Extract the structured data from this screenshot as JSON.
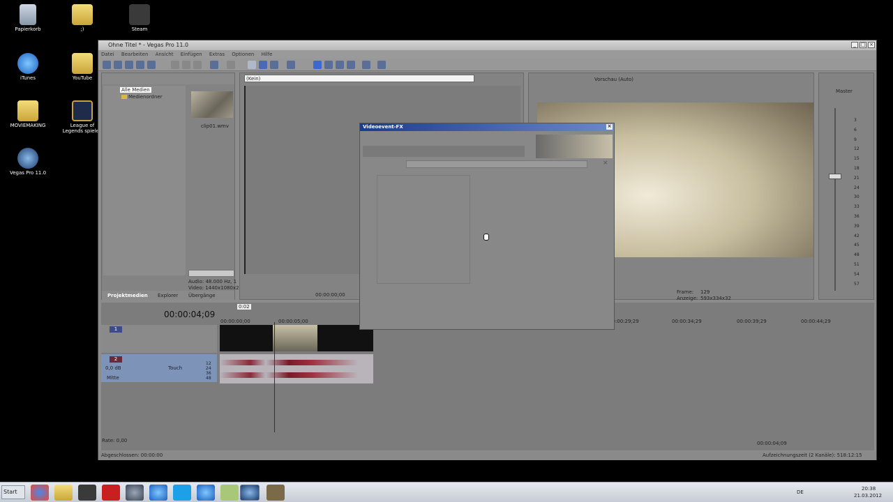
{
  "desktop": {
    "icons": [
      {
        "label": "Papierkorb"
      },
      {
        "label": ";)"
      },
      {
        "label": "Steam"
      },
      {
        "label": "iTunes"
      },
      {
        "label": "YouTube"
      },
      {
        "label": "MOVIEMAKING"
      },
      {
        "label": "League of Legends spielen"
      },
      {
        "label": "Vegas Pro 11.0"
      }
    ]
  },
  "window": {
    "title": "Ohne Titel * - Vegas Pro 11.0",
    "menu": [
      "Datei",
      "Bearbeiten",
      "Ansicht",
      "Einfügen",
      "Extras",
      "Optionen",
      "Hilfe"
    ]
  },
  "media": {
    "tree": [
      "Alle Medien",
      "Medienordner"
    ],
    "file_name": "clip01.wmv",
    "info_lines": [
      "Audio: 48.000 Hz, 1",
      "Video: 1440x1080x2"
    ],
    "tabs": [
      "Projektmedien",
      "Explorer",
      "Übergänge"
    ]
  },
  "trimmer": {
    "selector_value": "(Kein)",
    "timecode": "00:00:00;00"
  },
  "preview": {
    "mode": "Vorschau (Auto)",
    "frame_label": "Frame:",
    "frame_value": "129",
    "display_label": "Anzeige:",
    "display_value": "593x334x32"
  },
  "mixer": {
    "master_label": "Master",
    "scale": [
      "3",
      "6",
      "9",
      "12",
      "15",
      "18",
      "21",
      "24",
      "30",
      "33",
      "36",
      "39",
      "42",
      "45",
      "48",
      "51",
      "54",
      "57"
    ]
  },
  "timeline": {
    "time": "00:00:04;09",
    "marker": "0:02",
    "ruler": [
      "00:00:00;00",
      "00:00:05;00",
      "00:00:29;29",
      "00:00:34;29",
      "00:00:39;29",
      "00:00:44;29"
    ],
    "audio_track": {
      "vol": "0,0 dB",
      "pan": "Mitte",
      "mode": "Touch",
      "numbers": [
        "12",
        "24",
        "36",
        "48"
      ]
    },
    "rate": "Rate: 0,00",
    "transport_time": "00:00:04;09",
    "video_track_num": "1",
    "audio_track_num": "2"
  },
  "status": {
    "left": "Abgeschlossen: 00:00:00",
    "right": "Aufzeichnungszeit (2 Kanäle): 518:12:15"
  },
  "dialog": {
    "title": "Videoevent-FX"
  },
  "taskbar": {
    "start": "Start",
    "lang": "DE",
    "time": "20:38",
    "date": "21.03.2012"
  }
}
